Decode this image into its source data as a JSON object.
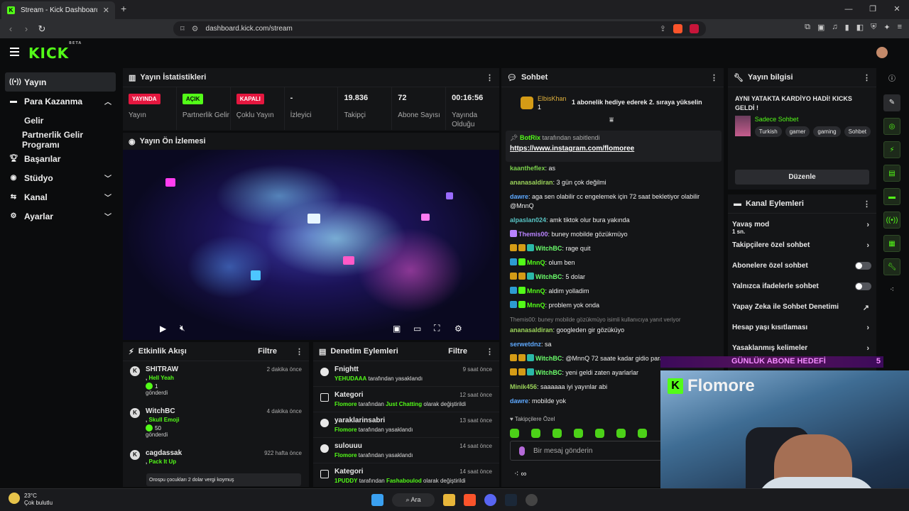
{
  "browser": {
    "tab_title": "Stream - Kick Dashboard",
    "url": "dashboard.kick.com/stream"
  },
  "app": {
    "logo": "KICK",
    "logo_badge": "BETA"
  },
  "sidebar": {
    "items": [
      {
        "label": "Yayın",
        "icon": "broadcast-icon"
      },
      {
        "label": "Para Kazanma",
        "icon": "money-icon"
      },
      {
        "label": "Gelir"
      },
      {
        "label": "Partnerlik Gelir Programı"
      },
      {
        "label": "Başarılar",
        "icon": "trophy-icon"
      },
      {
        "label": "Stüdyo",
        "icon": "studio-icon"
      },
      {
        "label": "Kanal",
        "icon": "channel-icon"
      },
      {
        "label": "Ayarlar",
        "icon": "gear-icon"
      }
    ]
  },
  "stats": {
    "title": "Yayın İstatistikleri",
    "cells": [
      {
        "badge": "YAYINDA",
        "label": "Yayın"
      },
      {
        "badge": "AÇIK",
        "label": "Partnerlik Gelir"
      },
      {
        "badge": "KAPALI",
        "label": "Çoklu Yayın"
      },
      {
        "value": "-",
        "label": "İzleyici"
      },
      {
        "value": "19.836",
        "label": "Takipçi"
      },
      {
        "value": "72",
        "label": "Abone Sayısı"
      },
      {
        "value": "00:16:56",
        "label": "Yayında Olduğu"
      }
    ]
  },
  "preview": {
    "title": "Yayın Ön İzlemesi"
  },
  "events": {
    "title": "Etkinlik Akışı",
    "filter": "Filtre",
    "items": [
      {
        "name": "SHITRAW",
        "time": "2 dakika önce",
        "sub": "Hell Yeah",
        "count": "1",
        "sent": "gönderdi"
      },
      {
        "name": "WitchBC",
        "time": "4 dakika önce",
        "sub": "Skull Emoji",
        "count": "50",
        "sent": "gönderdi"
      },
      {
        "name": "cagdassak",
        "time": "922 hafta önce",
        "sub": "Pack It Up"
      }
    ],
    "note": "Orospu çocukları 2 dolar vergi koymuş"
  },
  "moderation": {
    "title": "Denetim Eylemleri",
    "filter": "Filtre",
    "items": [
      {
        "title": "Fnightt",
        "time": "9 saat önce",
        "actor": "YEHUDAAA",
        "text": "tarafından yasaklandı"
      },
      {
        "title": "Kategori",
        "time": "12 saat önce",
        "actor": "Flomore",
        "text": "tarafından",
        "target": "Just Chatting",
        "tail": "olarak değiştirildi"
      },
      {
        "title": "yaraklarinsabri",
        "time": "13 saat önce",
        "actor": "Flomore",
        "text": "tarafından yasaklandı"
      },
      {
        "title": "sulouuu",
        "time": "14 saat önce",
        "actor": "Flomore",
        "text": "tarafından yasaklandı"
      },
      {
        "title": "Kategori",
        "time": "14 saat önce",
        "actor": "1PUDDY",
        "text": "tarafından",
        "target": "Fashaboulod",
        "tail": "olarak değiştirildi"
      }
    ]
  },
  "chat": {
    "title": "Sohbet",
    "gift": {
      "user": "ElbisKhan",
      "count": "1",
      "text": "1 abonelik hediye ederek 2. sıraya yükselin"
    },
    "pinned": {
      "by": "BotRix",
      "text": "tarafından sabitlendi",
      "link": "https://www.instagram.com/flomoree"
    },
    "messages": [
      {
        "user": "kaantheflex",
        "text": ": as",
        "color": "#7ad14b"
      },
      {
        "user": "ananasaldiran",
        "text": ": 3 gün çok değilmi",
        "color": "#9bd35a"
      },
      {
        "user": "dawre",
        "text": ": aga sen olabilir cc engelemek için 72 saat bekletiyor olabilir @MnnQ",
        "color": "#5ea9ff"
      },
      {
        "user": "alpaslan024",
        "text": ": amk tiktok olur bura yakında",
        "color": "#58c4c4"
      },
      {
        "user": "Themis00",
        "text": ": buney mobilde gözükmüyo",
        "color": "#b983ff",
        "badges": [
          "#b983ff"
        ]
      },
      {
        "user": "WitchBC",
        "text": ": rage quit",
        "color": "#6bff6b",
        "badges": [
          "#d49b16",
          "#d49b16",
          "#2bb8a8"
        ]
      },
      {
        "user": "MnnQ",
        "text": ": olum ben",
        "color": "#53fc18",
        "badges": [
          "#2d9bd1",
          "#53fc18"
        ]
      },
      {
        "user": "WitchBC",
        "text": ": 5 dolar",
        "color": "#6bff6b",
        "badges": [
          "#d49b16",
          "#d49b16",
          "#2bb8a8"
        ]
      },
      {
        "user": "MnnQ",
        "text": ": aldim yolladim",
        "color": "#53fc18",
        "badges": [
          "#2d9bd1",
          "#53fc18"
        ]
      },
      {
        "user": "MnnQ",
        "text": ": problem yok onda",
        "color": "#53fc18",
        "badges": [
          "#2d9bd1",
          "#53fc18"
        ]
      },
      {
        "reply": "Themis00: buney mobilde gözükmüyo isimli kullanıcıya yanıt veriyor"
      },
      {
        "user": "ananasaldiran",
        "text": ": googleden gir gözüküyo",
        "color": "#9bd35a"
      },
      {
        "user": "serwetdnz",
        "text": ": sa",
        "color": "#5ea9ff"
      },
      {
        "user": "WitchBC",
        "text": ": @MnnQ 72 saate kadar gidio para",
        "color": "#6bff6b",
        "badges": [
          "#d49b16",
          "#d49b16",
          "#2bb8a8"
        ]
      },
      {
        "user": "WitchBC",
        "text": ": yeni geldi zaten ayarlarlar",
        "color": "#6bff6b",
        "badges": [
          "#d49b16",
          "#d49b16",
          "#2bb8a8"
        ]
      },
      {
        "user": "Minik456",
        "text": ": saaaaaa iyi yayınlar abi",
        "color": "#9bd35a"
      },
      {
        "user": "dawre",
        "text": ": mobilde yok",
        "color": "#5ea9ff"
      }
    ],
    "follower_only": "Takipçilere Özel",
    "input_placeholder": "Bir mesaj gönderin"
  },
  "stream_info": {
    "title": "Yayın bilgisi",
    "stream_title": "AYNI YATAKTA KARDİYO HADİ! KICKS GELDİ !",
    "category": "Sadece Sohbet",
    "tags": [
      "Turkish",
      "gamer",
      "gaming",
      "Sohbet"
    ],
    "edit": "Düzenle"
  },
  "channel_actions": {
    "title": "Kanal Eylemleri",
    "items": [
      {
        "label": "Yavaş mod",
        "sub": "1 sn.",
        "kind": "chevron"
      },
      {
        "label": "Takipçilere özel sohbet",
        "kind": "chevron"
      },
      {
        "label": "Abonelere özel sohbet",
        "kind": "toggle"
      },
      {
        "label": "Yalnızca ifadelerle sohbet",
        "kind": "toggle"
      },
      {
        "label": "Yapay Zeka ile Sohbet Denetimi",
        "kind": "external"
      },
      {
        "label": "Hesap yaşı kısıtlaması",
        "kind": "chevron"
      },
      {
        "label": "Yasaklanmış kelimeler",
        "kind": "chevron"
      }
    ]
  },
  "overlay": {
    "goal": "GÜNLÜK ABONE HEDEFİ",
    "goal_count": "5",
    "streamer": "Flomore"
  },
  "taskbar": {
    "temp": "23°C",
    "weather": "Çok bulutlu",
    "search": "Ara"
  },
  "colors": {
    "accent": "#53fc18",
    "live": "#e5173f"
  }
}
